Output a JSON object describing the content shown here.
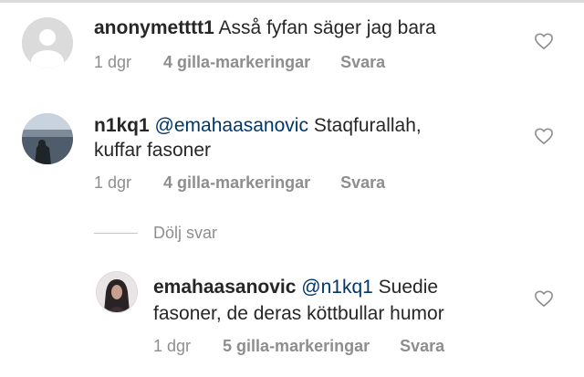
{
  "comments": [
    {
      "username": "anonymetttt1",
      "mention": "",
      "text": "Asså fyfan säger jag bara",
      "text_line2": "",
      "time": "1 dgr",
      "likes": "4 gilla-markeringar",
      "reply": "Svara",
      "avatar": "default-avatar-icon"
    },
    {
      "username": "n1kq1",
      "mention": "@emahaasanovic",
      "text": "Staqfurallah,",
      "text_line2": "kuffar fasoner",
      "time": "1 dgr",
      "likes": "4 gilla-markeringar",
      "reply": "Svara",
      "avatar": "lake-photo-avatar"
    }
  ],
  "hide_replies": "Dölj svar",
  "reply_comment": {
    "username": "emahaasanovic",
    "mention": "@n1kq1",
    "text": "Suedie",
    "text_line2": "fasoner, de deras köttbullar humor",
    "time": "1 dgr",
    "likes": "5 gilla-markeringar",
    "reply": "Svara",
    "avatar": "portrait-photo-avatar"
  },
  "icons": {
    "like": "heart-outline-icon"
  },
  "colors": {
    "text": "#262626",
    "muted": "#8e8e8e",
    "mention": "#00376b",
    "divider": "#dbdbdb"
  }
}
